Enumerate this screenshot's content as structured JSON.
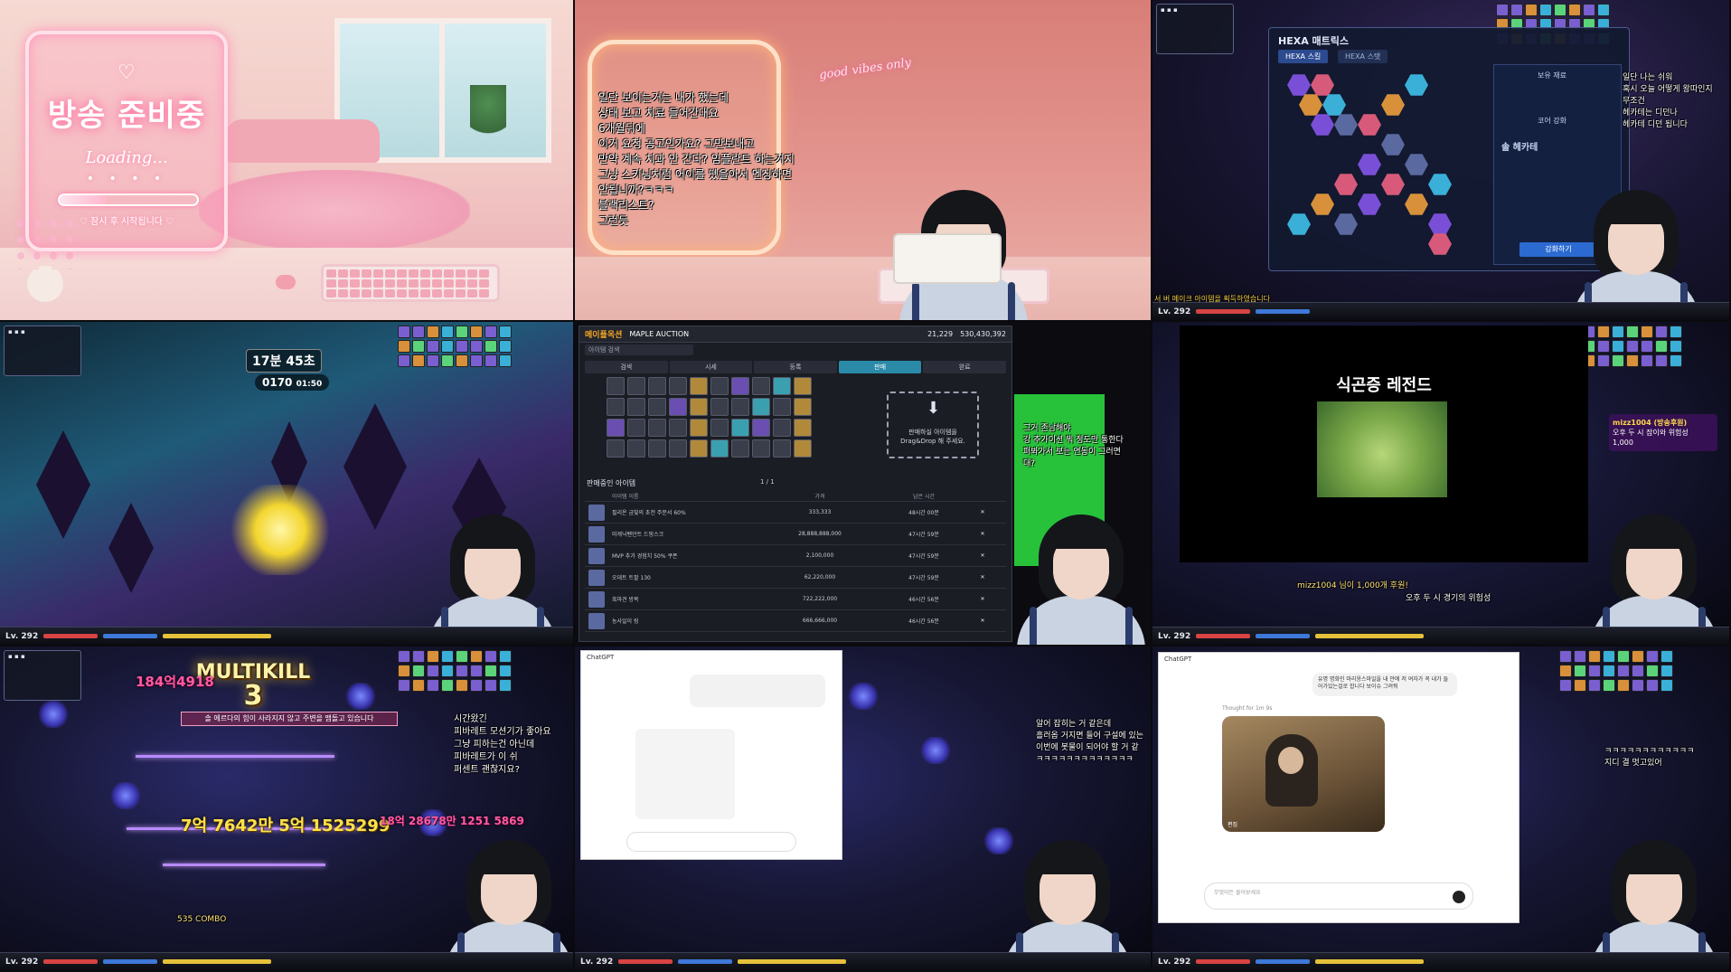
{
  "tile1": {
    "title": "방송 준비중",
    "loading": "Loading...",
    "dots": "• • • •",
    "progress": 0.35,
    "soon": "♡ 잠시 후 시작됩니다 ♡"
  },
  "tile2": {
    "neon_sign": "good vibes only",
    "chat_lines": [
      "일단 보이는거는 내가 했는데",
      "상태 보고 치료 들어간대요",
      "6개월뒤에",
      "이거 요청 공고인가요? 그만보내고",
      "만약 계속 치과 안 간다? 임플란트 하는거지",
      "그냥 스키닝처럼 어이를 뗐을아서 엔징하면",
      "안됩니까?ㅋㅋㅋ",
      "블랙리스트?",
      "그런듯"
    ]
  },
  "tile3": {
    "panel_title": "HEXA 매트릭스",
    "tab_a": "HEXA 스킬",
    "tab_b": "HEXA 스탯",
    "side_label_1": "보유 재료",
    "side_label_2": "코어 강화",
    "side_label_3": "솔 헤카테",
    "button": "강화하기",
    "level_text": "Lv. 292",
    "chat": [
      "일단 나는 쉬워",
      "혹시 오늘 어떻게 왕따인지",
      "무조건",
      "헤카테는 디던나",
      "헤카테 디던 됩니다"
    ],
    "bottom_msg": "서 버 메이크 아이템을 획득하였습니다"
  },
  "tile4": {
    "timer": "17분 45초",
    "count_label": "0170",
    "count_sub": "01:50",
    "level_text": "Lv. 292"
  },
  "tile5": {
    "logo": "메이플옥션",
    "logo_sub": "MAPLE AUCTION",
    "search_placeholder": "아이템 검색",
    "tabs": [
      "검색",
      "시세",
      "등록",
      "판매",
      "완료"
    ],
    "active_tab": 3,
    "count_a": "21,229",
    "count_b": "530,430,392",
    "drop_text_1": "판매하실 아이템을",
    "drop_text_2": "Drag&Drop 해 주세요.",
    "list_title": "판매중인 아이템",
    "page": "1 / 1",
    "col_name": "아이템 이름",
    "col_price": "가격",
    "col_time": "남은 시간",
    "rows": [
      {
        "name": "필리온 금빛의 초전 주문서 60%",
        "price": "333,333",
        "time": "48시간 00분"
      },
      {
        "name": "미캐닉펜던트 드핑스크",
        "price": "28,888,888,000",
        "time": "47시간 59분"
      },
      {
        "name": "MVP 추가 경험치 50% 쿠폰",
        "price": "2,100,000",
        "time": "47시간 59분"
      },
      {
        "name": "오데트 트팔 130",
        "price": "62,220,000",
        "time": "47시간 59분"
      },
      {
        "name": "흑마견 방목",
        "price": "722,222,000",
        "time": "46시간 56분"
      },
      {
        "name": "농사일이 링",
        "price": "666,666,000",
        "time": "46시간 56분"
      }
    ],
    "chat": [
      "그거 존남해야",
      "강 추가이션 뭐 정도만 통한다",
      "퍼봐가서 보는 연동이 그러면",
      "대?"
    ]
  },
  "tile6": {
    "title": "식곤증 레전드",
    "donation_name": "mizz1004 (방송후원)",
    "donation_msg": "오후 두 시 잠이와 위험성",
    "donation_amount": "1,000",
    "ticker": "mizz1004 님이 1,000개 후원!",
    "ticker2": "오후 두 시 경기의 위험성",
    "level_text": "Lv. 292"
  },
  "tile7": {
    "multikill": "MULTIKILL",
    "multikill_n": "3",
    "sysmsg": "솔 에르다의 힘이 사라지지 않고 주변을 맴돌고 있습니다",
    "dmg_1": "184억4918",
    "dmg_2": "7억 7642만 5억 1525299",
    "dmg_3": "18억 28678만 1251 5869",
    "combo": "535 COMBO",
    "chat": [
      "시간왔긴",
      "피바레트 모션기가 좋아요",
      "그냥 피하는건 아닌데",
      "피바레트가 이 쉬",
      "퍼센트 괜찮지요?"
    ],
    "level_text": "Lv. 292"
  },
  "tile8": {
    "app": "ChatGPT",
    "chat": [
      "알어 잡히는 거 같은데",
      "흘러옵 거지면 들어 구설에 있는",
      "이번에 봇물이 되어야 할 거 같",
      "ㅋㅋㅋㅋㅋㅋㅋㅋㅋㅋㅋㅋㅋ"
    ],
    "level_text": "Lv. 292"
  },
  "tile9": {
    "app": "ChatGPT",
    "prompt": "유명 명화인 마리옹스마일을 내 얀에 저 여자가 꼭 내가 들어가있는걸로 합니다 보이슈 그려줘",
    "thought": "Thought for 1m 9s",
    "input_placeholder": "무엇이든 물어보세요",
    "edit_label": "편집",
    "chat": [
      "ㅋㅋㅋㅋㅋㅋㅋㅋㅋㅋㅋㅋ",
      "지디 결 멋고있어"
    ],
    "level_text": "Lv. 292"
  }
}
